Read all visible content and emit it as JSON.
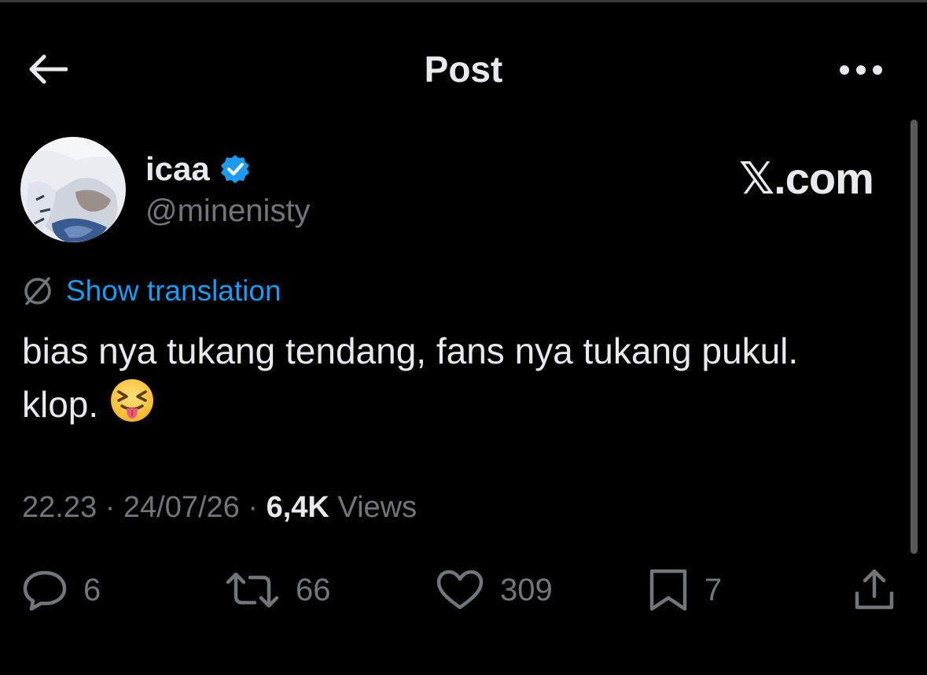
{
  "header": {
    "title": "Post",
    "back_icon": "arrow-left-icon",
    "more_icon": "more-horizontal-icon"
  },
  "author": {
    "name": "icaa",
    "handle": "@minenisty",
    "verified": true,
    "verified_color": "#1d9bf0"
  },
  "watermark": "𝕏.com",
  "translation": {
    "icon": "translate-globe-icon",
    "label": "Show translation",
    "color": "#1d9bf0"
  },
  "tweet": {
    "line1": "bias nya tukang tendang, fans nya tukang pukul.",
    "line2": "klop.",
    "emoji": "squinting-face-with-tongue"
  },
  "meta": {
    "time": "22.23",
    "sep1": "·",
    "date": "24/07/26",
    "sep2": "·",
    "views_count": "6,4K",
    "views_label": "Views"
  },
  "actions": {
    "replies": "6",
    "reposts": "66",
    "likes": "309",
    "bookmarks": "7"
  },
  "colors": {
    "background": "#000000",
    "text": "#e7e9ea",
    "muted": "#71767b",
    "accent": "#1d9bf0"
  }
}
